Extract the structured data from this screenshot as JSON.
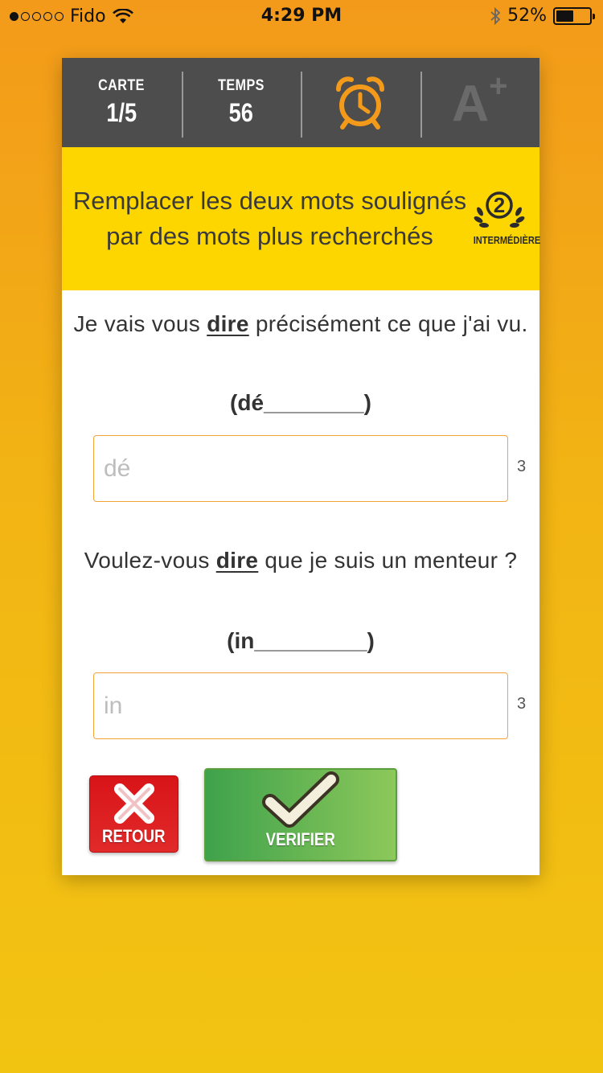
{
  "status_bar": {
    "carrier": "Fido",
    "time": "4:29 PM",
    "battery_percent": "52%",
    "battery_level": 0.52,
    "signal_dots_filled": 1,
    "signal_dots_total": 5
  },
  "header": {
    "card_label": "CARTE",
    "card_value": "1/5",
    "time_label": "TEMPS",
    "time_value": "56",
    "alarm_icon": "alarm-clock-icon",
    "grade_label": "A",
    "grade_suffix": "+"
  },
  "instruction": {
    "text": "Remplacer les deux mots soulignés par des mots plus recherchés",
    "level_number": "2",
    "level_label": "INTERMÉDIÈRE"
  },
  "questions": [
    {
      "before": "Je vais vous ",
      "underlined": "dire",
      "after": " précisément ce que j'ai vu.",
      "hint": "(dé________)",
      "placeholder": "dé",
      "value": "",
      "count": "3"
    },
    {
      "before": "Voulez-vous ",
      "underlined": "dire",
      "after": " que je suis un menteur ?",
      "hint": "(in_________)",
      "placeholder": "in",
      "value": "",
      "count": "3"
    }
  ],
  "buttons": {
    "back_label": "RETOUR",
    "verify_label": "VERIFIER"
  },
  "colors": {
    "header_bg": "#4d4d4d",
    "instruction_bg": "#fdd600",
    "input_border": "#f2a33a",
    "back_button": "#d81418",
    "verify_button": "#5cb552",
    "alarm": "#f39a1a"
  }
}
